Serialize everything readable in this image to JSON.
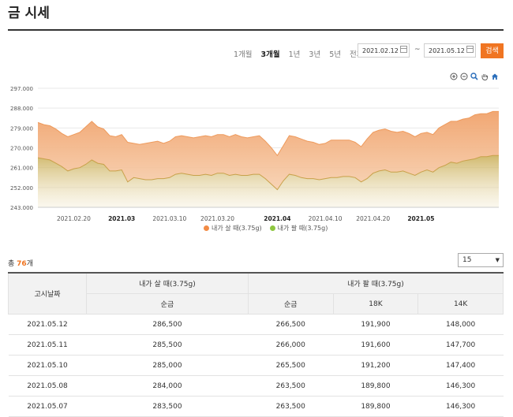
{
  "page": {
    "title": "금 시세"
  },
  "periods": [
    {
      "label": "1개월",
      "active": false
    },
    {
      "label": "3개월",
      "active": true
    },
    {
      "label": "1년",
      "active": false
    },
    {
      "label": "3년",
      "active": false
    },
    {
      "label": "5년",
      "active": false
    },
    {
      "label": "전체",
      "active": false
    }
  ],
  "date_range": {
    "start": "2021.02.12",
    "separator": "~",
    "end": "2021.05.12"
  },
  "search_label": "검색",
  "toolbar_icons": [
    "zoom-in-icon",
    "zoom-out-icon",
    "magnifier-icon",
    "hand-pan-icon",
    "home-icon"
  ],
  "colors": {
    "accent": "#f07522",
    "buy": "#f0a26b",
    "sell": "#c9ad54",
    "legend_buy": "#f28b45",
    "legend_sell": "#8dc63f"
  },
  "chart_data": {
    "type": "area",
    "ylim": [
      243000,
      297000
    ],
    "y_ticks": [
      "243.000",
      "252.000",
      "261.000",
      "270.000",
      "279.000",
      "288.000",
      "297.000"
    ],
    "y_tick_values": [
      243000,
      252000,
      261000,
      270000,
      279000,
      288000,
      297000
    ],
    "x_ticks": [
      {
        "label": "2021.02.20",
        "bold": false,
        "index": 6
      },
      {
        "label": "2021.03",
        "bold": true,
        "index": 14
      },
      {
        "label": "2021.03.10",
        "bold": false,
        "index": 22
      },
      {
        "label": "2021.03.20",
        "bold": false,
        "index": 30
      },
      {
        "label": "2021.04",
        "bold": true,
        "index": 40
      },
      {
        "label": "2021.04.10",
        "bold": false,
        "index": 48
      },
      {
        "label": "2021.04.20",
        "bold": false,
        "index": 56
      },
      {
        "label": "2021.05",
        "bold": true,
        "index": 64
      }
    ],
    "grid": true,
    "legend_position": "bottom-center",
    "series": [
      {
        "name": "내가 살 때(3.75g)",
        "values": [
          281500,
          280500,
          280000,
          278500,
          276500,
          275000,
          276000,
          277000,
          279500,
          282000,
          279500,
          278500,
          275500,
          275000,
          276000,
          272500,
          272000,
          271500,
          272000,
          272500,
          273000,
          272000,
          273000,
          275000,
          275500,
          275000,
          274500,
          275000,
          275500,
          275000,
          276000,
          276000,
          275000,
          276000,
          275000,
          274500,
          275000,
          275500,
          273000,
          270000,
          266500,
          271000,
          275500,
          275000,
          274000,
          273000,
          272500,
          271500,
          272000,
          273500,
          273500,
          273500,
          273500,
          272500,
          270500,
          274000,
          277000,
          278000,
          278500,
          277500,
          277000,
          277500,
          276500,
          275000,
          276500,
          277000,
          276000,
          279000,
          280500,
          282000,
          282000,
          283000,
          283500,
          285000,
          285500,
          285500,
          286500,
          286500
        ]
      },
      {
        "name": "내가 팔 때(3.75g)",
        "values": [
          265500,
          265000,
          264500,
          263000,
          261500,
          259500,
          260500,
          261000,
          262500,
          264500,
          263000,
          262500,
          259500,
          259500,
          260000,
          254500,
          256500,
          256000,
          255500,
          255500,
          256000,
          256000,
          256500,
          258000,
          258500,
          258000,
          257500,
          257500,
          258000,
          257500,
          258500,
          258500,
          257500,
          258000,
          257500,
          257500,
          258000,
          258000,
          256000,
          253500,
          251000,
          255000,
          258000,
          257500,
          256500,
          256000,
          256000,
          255500,
          256000,
          256500,
          256500,
          257000,
          257000,
          256500,
          254500,
          256000,
          258500,
          259500,
          260000,
          259000,
          259000,
          259500,
          258500,
          257500,
          259000,
          260000,
          259000,
          261000,
          262000,
          263500,
          263000,
          264000,
          264500,
          265000,
          266000,
          266000,
          266500,
          266500
        ]
      }
    ]
  },
  "legend": [
    {
      "label": "내가 살 때(3.75g)"
    },
    {
      "label": "내가 팔 때(3.75g)"
    }
  ],
  "summary": {
    "prefix": "총 ",
    "count": "76",
    "suffix": "개"
  },
  "page_size": "15",
  "table": {
    "header_date": "고시날짜",
    "header_buy": "내가 살 때(3.75g)",
    "header_sell": "내가 팔 때(3.75g)",
    "sub_buy": "순금",
    "sub_sell": [
      "순금",
      "18K",
      "14K"
    ],
    "rows": [
      [
        "2021.05.12",
        "286,500",
        "266,500",
        "191,900",
        "148,000"
      ],
      [
        "2021.05.11",
        "285,500",
        "266,000",
        "191,600",
        "147,700"
      ],
      [
        "2021.05.10",
        "285,000",
        "265,500",
        "191,200",
        "147,400"
      ],
      [
        "2021.05.08",
        "284,000",
        "263,500",
        "189,800",
        "146,300"
      ],
      [
        "2021.05.07",
        "283,500",
        "263,500",
        "189,800",
        "146,300"
      ]
    ]
  }
}
